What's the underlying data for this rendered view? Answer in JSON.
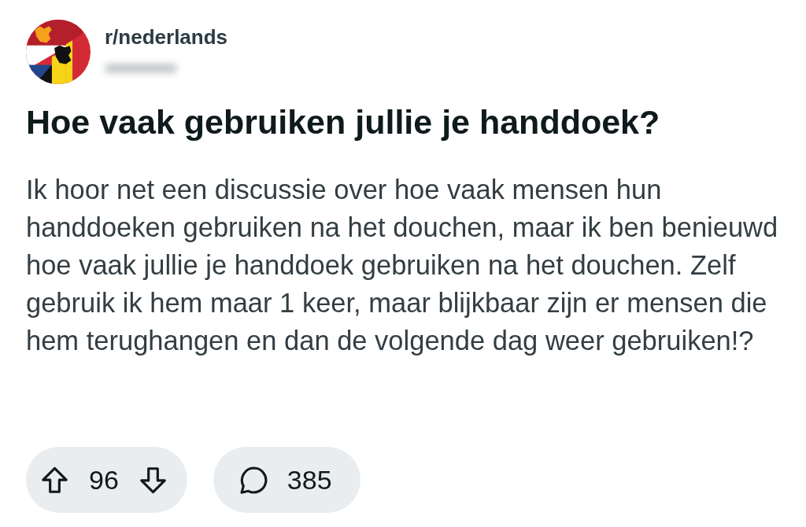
{
  "post": {
    "subreddit": "r/nederlands",
    "title": "Hoe vaak gebruiken jullie je handdoek?",
    "body": "Ik hoor net een discussie over hoe vaak mensen hun handdoeken gebruiken na het douchen, maar ik ben benieuwd hoe vaak jullie je handdoek gebruiken na het douchen. Zelf gebruik ik hem maar 1 keer, maar blijkbaar zijn er mensen die hem terughangen en dan de volgende dag weer gebruiken!?"
  },
  "actions": {
    "votes": "96",
    "comments": "385"
  }
}
